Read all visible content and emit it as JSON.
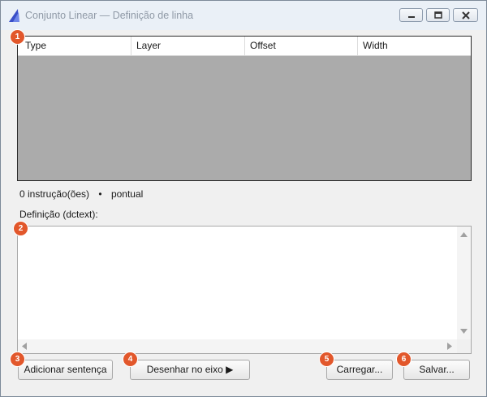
{
  "window": {
    "title": "Conjunto Linear — Definição de linha"
  },
  "table": {
    "columns": [
      "Type",
      "Layer",
      "Offset",
      "Width"
    ]
  },
  "status": {
    "count": "0 instrução(ões)",
    "separator": "•",
    "mode": "pontual"
  },
  "definition": {
    "label": "Definição (dctext):",
    "value": ""
  },
  "buttons": {
    "add": "Adicionar sentença",
    "draw": "Desenhar no eixo ▶",
    "load": "Carregar...",
    "save": "Salvar..."
  },
  "badges": [
    "1",
    "2",
    "3",
    "4",
    "5",
    "6"
  ],
  "colors": {
    "badge": "#e2572b",
    "table_empty_area": "#ababab",
    "title_text": "#8f99a6"
  }
}
